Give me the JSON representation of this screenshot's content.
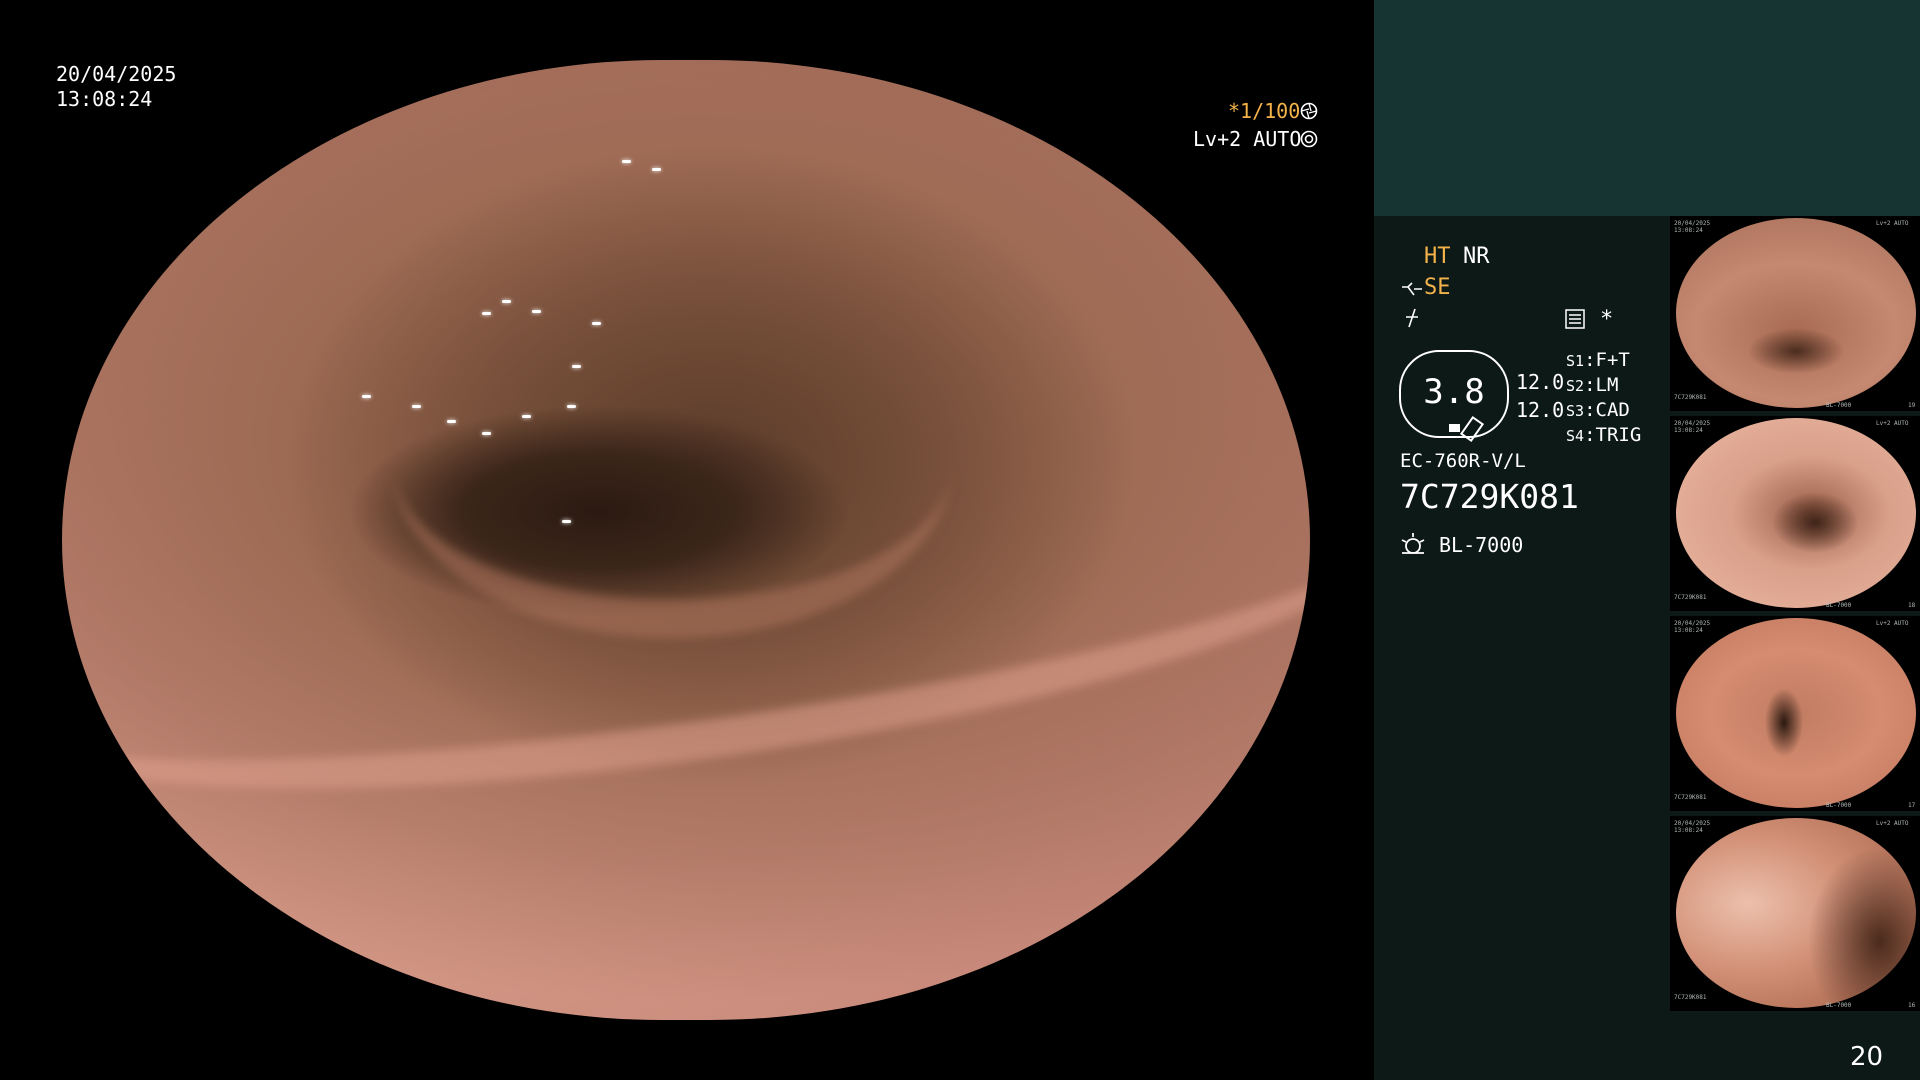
{
  "overlay": {
    "date": "20/04/2025",
    "time": "13:08:24",
    "shutter": "*1/100",
    "level": "Lv+2 AUTO"
  },
  "panel": {
    "ht": "HT",
    "nr": "NR",
    "se": "SE",
    "gauge_value": "3.8",
    "val_1": "12.0",
    "val_2": "12.0",
    "switches": [
      {
        "key": "S1",
        "value": "F+T"
      },
      {
        "key": "S2",
        "value": "LM"
      },
      {
        "key": "S3",
        "value": "CAD"
      },
      {
        "key": "S4",
        "value": "TRIG"
      }
    ],
    "scope_model": "EC-760R-V/L",
    "scope_serial": "7C729K081",
    "light_source": "BL-7000",
    "asterisk": "*"
  },
  "thumbnails": [
    {
      "date": "20/04/2025",
      "time": "13:08:24",
      "level": "Lv+2 AUTO",
      "serial": "7C729K081",
      "light": "BL-7000",
      "index": "19"
    },
    {
      "date": "20/04/2025",
      "time": "13:08:24",
      "level": "Lv+2 AUTO",
      "serial": "7C729K081",
      "light": "BL-7000",
      "index": "18"
    },
    {
      "date": "20/04/2025",
      "time": "13:08:24",
      "level": "Lv+2 AUTO",
      "serial": "7C729K081",
      "light": "BL-7000",
      "index": "17"
    },
    {
      "date": "20/04/2025",
      "time": "13:08:24",
      "level": "Lv+2 AUTO",
      "serial": "7C729K081",
      "light": "BL-7000",
      "index": "16"
    }
  ],
  "page_number": "20",
  "icons": {
    "shutter": "aperture-icon",
    "auto": "auto-exposure-icon",
    "se": "structure-enhance-icon",
    "color": "color-enhance-icon",
    "settings": "settings-list-icon",
    "light": "light-source-icon"
  },
  "colors": {
    "accent_orange": "#f4b24a",
    "panel_top": "#163432",
    "panel_bg": "#0d1917"
  }
}
